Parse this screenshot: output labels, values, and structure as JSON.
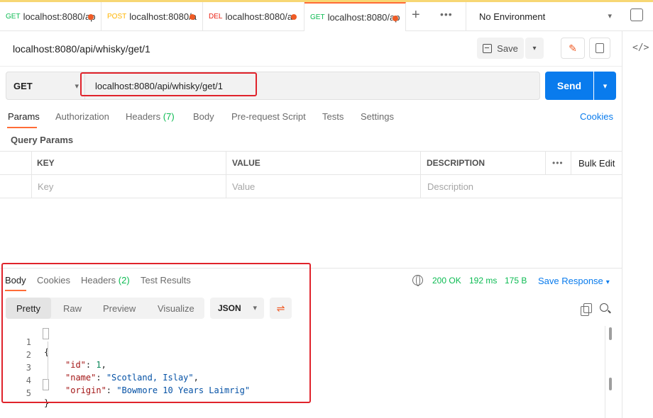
{
  "tabs": [
    {
      "method": "GET",
      "url": "localhost:8080/ap",
      "modified": true
    },
    {
      "method": "POST",
      "url": "localhost:8080/a",
      "modified": true
    },
    {
      "method": "DEL",
      "url": "localhost:8080/a",
      "modified": true
    },
    {
      "method": "GET",
      "url": "localhost:8080/ap",
      "modified": true
    }
  ],
  "environment": "No Environment",
  "request": {
    "name": "localhost:8080/api/whisky/get/1",
    "save_label": "Save",
    "method": "GET",
    "url": "localhost:8080/api/whisky/get/1",
    "send_label": "Send"
  },
  "request_tabs": {
    "params": "Params",
    "authorization": "Authorization",
    "headers": "Headers",
    "headers_count": "(7)",
    "body": "Body",
    "pre_request": "Pre-request Script",
    "tests": "Tests",
    "settings": "Settings",
    "cookies": "Cookies"
  },
  "query_params": {
    "title": "Query Params",
    "columns": [
      "KEY",
      "VALUE",
      "DESCRIPTION"
    ],
    "bulk_edit": "Bulk Edit",
    "placeholders": {
      "key": "Key",
      "value": "Value",
      "description": "Description"
    }
  },
  "response": {
    "tabs": {
      "body": "Body",
      "cookies": "Cookies",
      "headers": "Headers",
      "headers_count": "(2)",
      "test_results": "Test Results"
    },
    "status": "200 OK",
    "time": "192 ms",
    "size": "175 B",
    "save_response": "Save Response",
    "views": [
      "Pretty",
      "Raw",
      "Preview",
      "Visualize"
    ],
    "format": "JSON",
    "lines": [
      {
        "num": "1",
        "text": "{"
      },
      {
        "num": "2",
        "key": "\"id\"",
        "value": "1",
        "type": "number"
      },
      {
        "num": "3",
        "key": "\"name\"",
        "value": "\"Scotland, Islay\"",
        "type": "string"
      },
      {
        "num": "4",
        "key": "\"origin\"",
        "value": "\"Bowmore 10 Years Laimrig\"",
        "type": "string"
      },
      {
        "num": "5",
        "text": "}"
      }
    ]
  },
  "colors": {
    "accent": "#ff6c37",
    "send": "#097bed",
    "success": "#0cbb52",
    "highlight": "#e0232b"
  }
}
